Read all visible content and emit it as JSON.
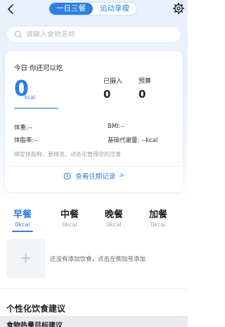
{
  "colors": {
    "accent": "#2d7fe0",
    "muted": "#9aa3ad"
  },
  "header": {
    "back_icon": "chevron-left-icon",
    "tabs": [
      {
        "label": "一日三餐",
        "active": true
      },
      {
        "label": "运动享瘦",
        "active": false
      }
    ],
    "settings_icon": "gear-icon"
  },
  "search": {
    "placeholder": "请输入食物名称",
    "value": ""
  },
  "summary": {
    "title": "今日  你还可以吃",
    "remaining": "0",
    "remaining_unit": "kcal",
    "eaten_label": "已摄入",
    "eaten_value": "0",
    "budget_label": "预算",
    "budget_value": "0",
    "weight": "体重:--",
    "bmi": "BMI:--",
    "body_fat": "体脂率:--",
    "bmr": "基础代谢量: --kcal",
    "hint": "绑定体脂称，更精准、动态化管理您的饮食",
    "history_label": "查看往期记录",
    "history_arrow": ">"
  },
  "meals": [
    {
      "name": "早餐",
      "kcal": "0kcal",
      "active": true
    },
    {
      "name": "中餐",
      "kcal": "0kcal",
      "active": false
    },
    {
      "name": "晚餐",
      "kcal": "0kcal",
      "active": false
    },
    {
      "name": "加餐",
      "kcal": "0kcal",
      "active": false
    }
  ],
  "meal_add": {
    "plus": "+",
    "empty_hint": "还没有添加饮食，点击左侧加号添加"
  },
  "section": {
    "title": "个性化饮食建议",
    "next_peek": "食物热量目标建议"
  }
}
